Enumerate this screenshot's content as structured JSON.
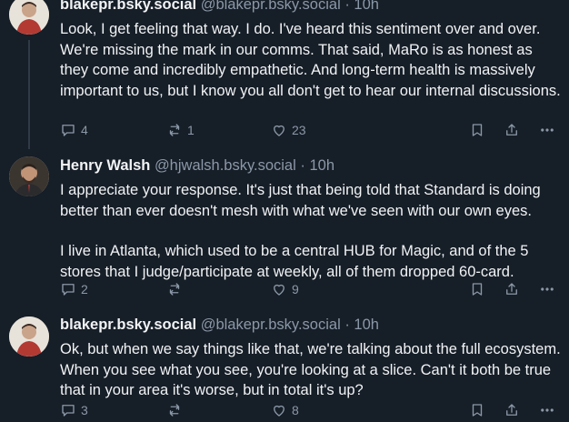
{
  "posts": [
    {
      "name": "blakepr.bsky.social",
      "handle": "@blakepr.bsky.social",
      "sep": "·",
      "time": "10h",
      "paragraphs": [
        "Look, I get feeling that way. I do. I've heard this sentiment over and over. We're missing the mark in our comms. That said, MaRo is as honest as they come and incredibly empathetic. And long-term health is massively important to us, but I know you all don't get to hear our internal discussions."
      ],
      "reply_count": "4",
      "repost_count": "1",
      "like_count": "23"
    },
    {
      "name": "Henry Walsh",
      "handle": "@hjwalsh.bsky.social",
      "sep": "·",
      "time": "10h",
      "paragraphs": [
        "I appreciate your response. It's just that being told that Standard is doing better than ever doesn't mesh with what we've seen with our own eyes.",
        "I live in Atlanta, which used to be a central HUB for Magic, and of the 5 stores that I judge/participate at weekly, all of them dropped 60-card."
      ],
      "reply_count": "2",
      "repost_count": "",
      "like_count": "9"
    },
    {
      "name": "blakepr.bsky.social",
      "handle": "@blakepr.bsky.social",
      "sep": "·",
      "time": "10h",
      "paragraphs": [
        "Ok, but when we say things like that, we're talking about the full ecosystem. When you see what you see, you're looking at a slice. Can't it both be true that in your area it's worse, but in total it's up?"
      ],
      "reply_count": "3",
      "repost_count": "",
      "like_count": "8"
    }
  ],
  "icons": {
    "reply": "reply-icon",
    "repost": "repost-icon",
    "like": "heart-icon",
    "save": "bookmark-icon",
    "share": "share-icon",
    "more": "more-icon"
  },
  "colors": {
    "background": "#161e27",
    "text": "#f1f3f5",
    "muted": "#8b98a8"
  }
}
